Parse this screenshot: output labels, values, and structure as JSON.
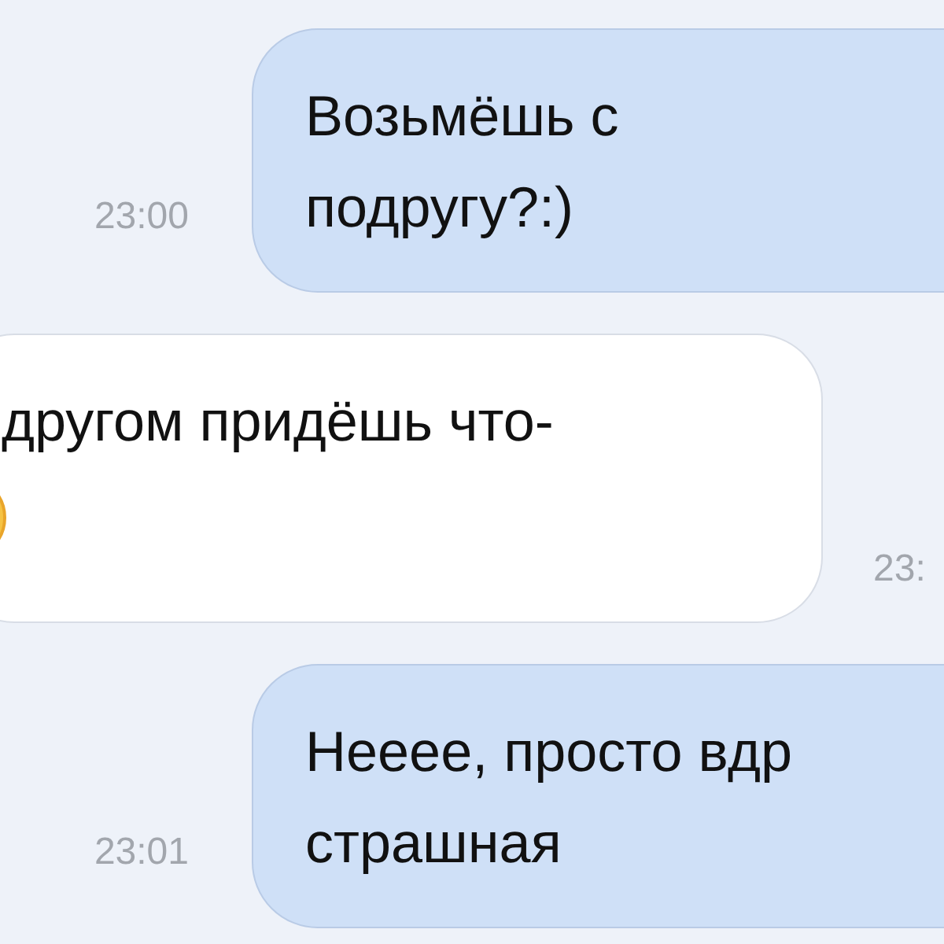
{
  "messages": [
    {
      "kind": "sent",
      "lines": [
        "Возьмёшь с",
        "подругу?:)"
      ],
      "time": "23:00",
      "emoji": false
    },
    {
      "kind": "received",
      "lines": [
        "другом придёшь что-"
      ],
      "time": "23:",
      "emoji": true
    },
    {
      "kind": "sent",
      "lines": [
        "Нееее, просто вдр",
        "страшная"
      ],
      "time": "23:01",
      "emoji": false
    }
  ]
}
